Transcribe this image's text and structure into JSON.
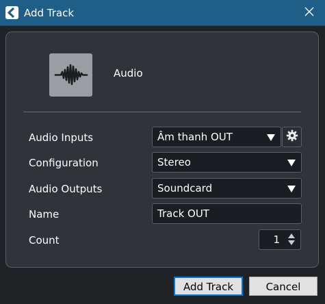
{
  "window": {
    "title": "Add Track",
    "app_icon": "cubase-logo-icon",
    "close_icon": "close-icon"
  },
  "track_type": {
    "icon": "audio-waveform-icon",
    "label": "Audio"
  },
  "form": {
    "audio_inputs": {
      "label": "Audio Inputs",
      "value": "Âm thanh OUT",
      "settings_icon": "gear-icon"
    },
    "configuration": {
      "label": "Configuration",
      "value": "Stereo"
    },
    "audio_outputs": {
      "label": "Audio Outputs",
      "value": "Soundcard"
    },
    "name": {
      "label": "Name",
      "value": "Track OUT"
    },
    "count": {
      "label": "Count",
      "value": "1"
    }
  },
  "buttons": {
    "add_track": "Add Track",
    "cancel": "Cancel"
  },
  "colors": {
    "titlebar": "#1f5e86",
    "background": "#1f2326",
    "panel": "#30343a",
    "field": "#1a1d21",
    "accent": "#0078d7"
  }
}
